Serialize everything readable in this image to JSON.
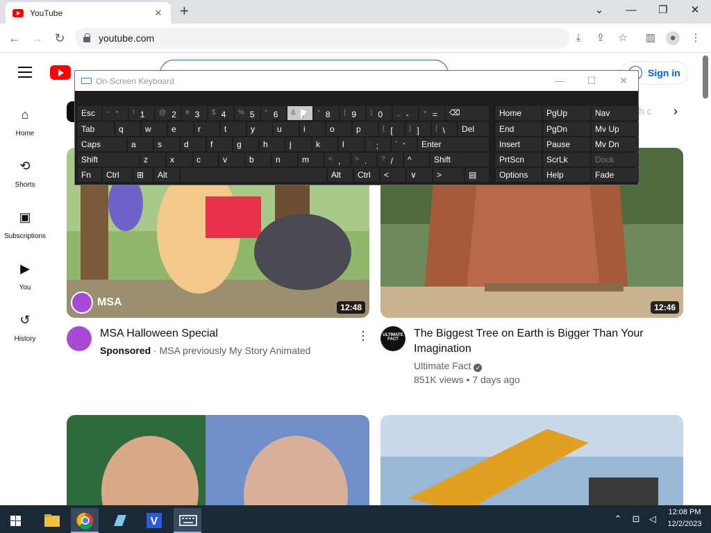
{
  "browser": {
    "tab_title": "YouTube",
    "tab_close": "✕",
    "new_tab": "+",
    "url": "youtube.com"
  },
  "youtube": {
    "sign_in": "Sign in",
    "guide": [
      {
        "label": "Home",
        "icon": "home-icon"
      },
      {
        "label": "Shorts",
        "icon": "shorts-icon"
      },
      {
        "label": "Subscriptions",
        "icon": "subscriptions-icon"
      },
      {
        "label": "You",
        "icon": "you-icon"
      },
      {
        "label": "History",
        "icon": "history-icon"
      }
    ],
    "chip_fade_text": "h c",
    "videos": [
      {
        "title": "MSA Halloween Special",
        "sponsored": "Sponsored",
        "channel": "MSA previously My Story Animated",
        "duration": "12:48",
        "thumb_badge": "MSA"
      },
      {
        "title": "The Biggest Tree on Earth is Bigger Than Your Imagination",
        "channel": "Ultimate Fact",
        "meta": "851K views • 7 days ago",
        "duration": "12:46",
        "avatar_text": "ULTIMATE FACT"
      }
    ]
  },
  "osk": {
    "title": "On-Screen Keyboard",
    "row1": [
      {
        "main": "Esc"
      },
      {
        "shift": "~",
        "main": "`"
      },
      {
        "shift": "!",
        "main": "1"
      },
      {
        "shift": "@",
        "main": "2"
      },
      {
        "shift": "#",
        "main": "3"
      },
      {
        "shift": "$",
        "main": "4"
      },
      {
        "shift": "%",
        "main": "5"
      },
      {
        "shift": "^",
        "main": "6"
      },
      {
        "shift": "&",
        "main": "7"
      },
      {
        "shift": "*",
        "main": "8"
      },
      {
        "shift": "(",
        "main": "9"
      },
      {
        "shift": ")",
        "main": "0"
      },
      {
        "shift": "_",
        "main": "-"
      },
      {
        "shift": "+",
        "main": "="
      },
      {
        "main": "⌫"
      }
    ],
    "row2": [
      "Tab",
      "q",
      "w",
      "e",
      "r",
      "t",
      "y",
      "u",
      "i",
      "o",
      "p",
      "[",
      "]",
      "\\",
      "Del"
    ],
    "row2_shift": {
      "open": "{",
      "close": "}",
      "pipe": "|"
    },
    "row3": [
      "Caps",
      "a",
      "s",
      "d",
      "f",
      "g",
      "h",
      "j",
      "k",
      "l",
      ";",
      "'",
      "Enter"
    ],
    "row3_shift": {
      "colon": ":",
      "quote": "\""
    },
    "row4": [
      "Shift",
      "z",
      "x",
      "c",
      "v",
      "b",
      "n",
      "m",
      ",",
      ".",
      "/",
      "^",
      "Shift"
    ],
    "row4_shift": {
      "lt": "<",
      "gt": ">",
      "q": "?"
    },
    "row5": [
      "Fn",
      "Ctrl",
      "⊞",
      "Alt",
      "",
      "Alt",
      "Ctrl",
      "<",
      "∨",
      ">",
      "▤"
    ],
    "nav": [
      [
        "Home",
        "PgUp",
        "Nav"
      ],
      [
        "End",
        "PgDn",
        "Mv Up"
      ],
      [
        "Insert",
        "Pause",
        "Mv Dn"
      ],
      [
        "PrtScn",
        "ScrLk",
        "Dock"
      ],
      [
        "Options",
        "Help",
        "Fade"
      ]
    ]
  },
  "taskbar": {
    "time": "12:08 PM",
    "date": "12/2/2023",
    "apps": [
      "start-icon",
      "file-explorer-icon",
      "chrome-icon",
      "notepad-icon",
      "v-app-icon",
      "on-screen-keyboard-icon"
    ]
  }
}
